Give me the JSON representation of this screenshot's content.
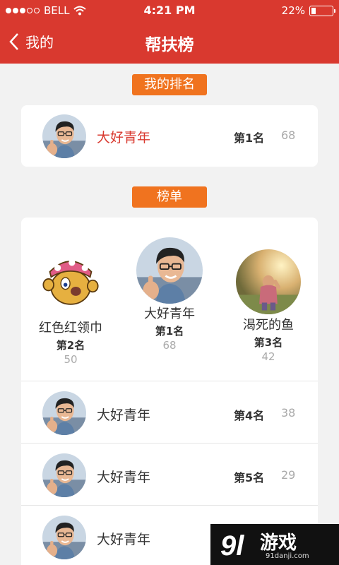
{
  "status_bar": {
    "carrier": "BELL",
    "time": "4:21 PM",
    "battery_percent": "22%",
    "battery_level": 0.22,
    "signal_icon": "signal-dots-icon",
    "wifi_icon": "wifi-icon"
  },
  "nav": {
    "back_label": "我的",
    "title": "帮扶榜",
    "back_icon": "chevron-left-icon"
  },
  "my_rank": {
    "section_label": "我的排名",
    "name": "大好青年",
    "rank": "第1名",
    "score": "68"
  },
  "leaderboard": {
    "section_label": "榜单",
    "podium": [
      {
        "name": "大好青年",
        "rank": "第1名",
        "score": "68"
      },
      {
        "name": "红色红领巾",
        "rank": "第2名",
        "score": "50"
      },
      {
        "name": "渴死的鱼",
        "rank": "第3名",
        "score": "42"
      }
    ],
    "rows": [
      {
        "name": "大好青年",
        "rank": "第4名",
        "score": "38"
      },
      {
        "name": "大好青年",
        "rank": "第5名",
        "score": "29"
      },
      {
        "name": "大好青年",
        "rank": "",
        "score": ""
      }
    ]
  },
  "watermark": {
    "brand": "游戏",
    "url": "91danji.com"
  },
  "colors": {
    "primary": "#d9392f",
    "tag": "#f0731f",
    "background": "#f2f2f2"
  }
}
